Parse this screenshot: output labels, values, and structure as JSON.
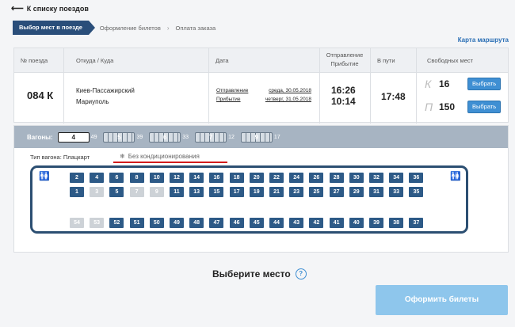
{
  "nav": {
    "back_label": "К списку поездов"
  },
  "steps": [
    {
      "label": "Выбор мест в поезде",
      "active": true
    },
    {
      "label": "Оформление билетов"
    },
    {
      "label": "Оплата заказа"
    }
  ],
  "route_map_link": "Карта маршрута",
  "table": {
    "headers": {
      "train_no": "№ поезда",
      "from_to": "Откуда / Куда",
      "date": "Дата",
      "dep_arr_1": "Отправление",
      "dep_arr_2": "Прибытие",
      "travel": "В пути",
      "free": "Свободных мест"
    },
    "row": {
      "train_no": "084 К",
      "from": "Киев-Пассажирский",
      "to": "Мариуполь",
      "dep_label": "Отправление",
      "dep_date": "среда, 30.05.2018",
      "arr_label": "Прибытие",
      "arr_date": "четверг, 31.05.2018",
      "dep_time": "16:26",
      "arr_time": "10:14",
      "travel_time": "17:48",
      "seat_classes": [
        {
          "cls": "К",
          "count": "16",
          "button": "Выбрать"
        },
        {
          "cls": "П",
          "count": "150",
          "button": "Выбрать"
        }
      ]
    }
  },
  "wagons": {
    "label": "Вагоны:",
    "items": [
      {
        "num": "4",
        "free": "49",
        "selected": true
      },
      {
        "num": "5",
        "free": "39"
      },
      {
        "num": "6",
        "free": "33"
      },
      {
        "num": "7",
        "free": "12"
      },
      {
        "num": "9",
        "free": "17"
      }
    ]
  },
  "wagon_type": "Тип вагона: Плацкарт",
  "no_ac": "Без кондиционирования",
  "seats": {
    "top_upper": [
      "2",
      "4",
      "6",
      "8",
      "10",
      "12",
      "14",
      "16",
      "18",
      "20",
      "22",
      "24",
      "26",
      "28",
      "30",
      "32",
      "34",
      "36"
    ],
    "top_lower": [
      "1",
      "3",
      "5",
      "7",
      "9",
      "11",
      "13",
      "15",
      "17",
      "19",
      "21",
      "23",
      "25",
      "27",
      "29",
      "31",
      "33",
      "35"
    ],
    "side": [
      "54",
      "53",
      "52",
      "51",
      "50",
      "49",
      "48",
      "47",
      "46",
      "45",
      "44",
      "43",
      "42",
      "41",
      "40",
      "39",
      "38",
      "37"
    ],
    "taken": [
      "3",
      "7",
      "9",
      "54",
      "53"
    ]
  },
  "choose_seat": "Выберите место",
  "help_icon": "question-icon",
  "order_button": "Оформить билеты"
}
